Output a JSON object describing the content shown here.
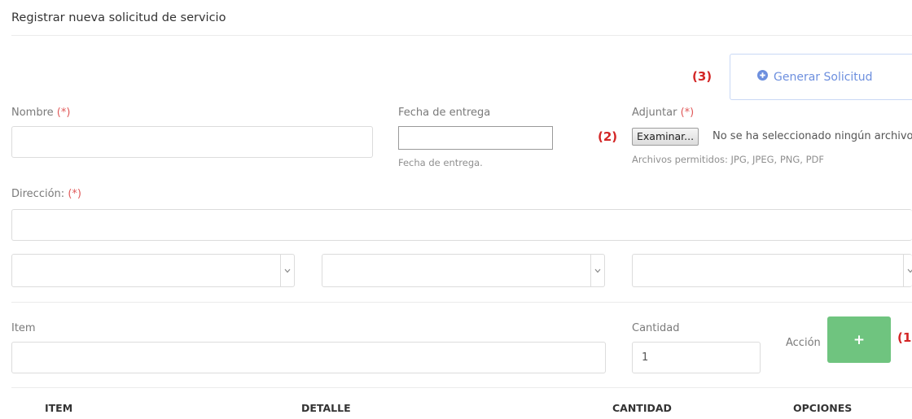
{
  "header": {
    "title": "Registrar nueva solicitud de servicio"
  },
  "actions": {
    "generate_label": "Generar Solicitud",
    "add_label": "+"
  },
  "markers": {
    "m1": "(1",
    "m2": "(2)",
    "m3": "(3)"
  },
  "form": {
    "required_mark": "(*)",
    "name_label": "Nombre",
    "name_value": "",
    "date_label": "Fecha de entrega",
    "date_value": "",
    "date_help": "Fecha de entrega.",
    "attach_label": "Adjuntar",
    "attach_button": "Examinar...",
    "attach_status": "No se ha seleccionado ningún archivo",
    "attach_help": "Archivos permitidos: JPG, JPEG, PNG, PDF",
    "address_label": "Dirección:",
    "address_value": "",
    "selects": [
      "",
      "",
      ""
    ],
    "item_label": "Item",
    "item_value": "",
    "qty_label": "Cantidad",
    "qty_value": "1",
    "action_label": "Acción"
  },
  "table": {
    "columns": [
      "ITEM",
      "DETALLE",
      "CANTIDAD",
      "OPCIONES"
    ]
  },
  "colors": {
    "required": "#e05a5a",
    "add_button": "#6fc47f",
    "generate_border": "#c9d8f5",
    "generate_text": "#6d8fde",
    "marker": "#d32626"
  }
}
